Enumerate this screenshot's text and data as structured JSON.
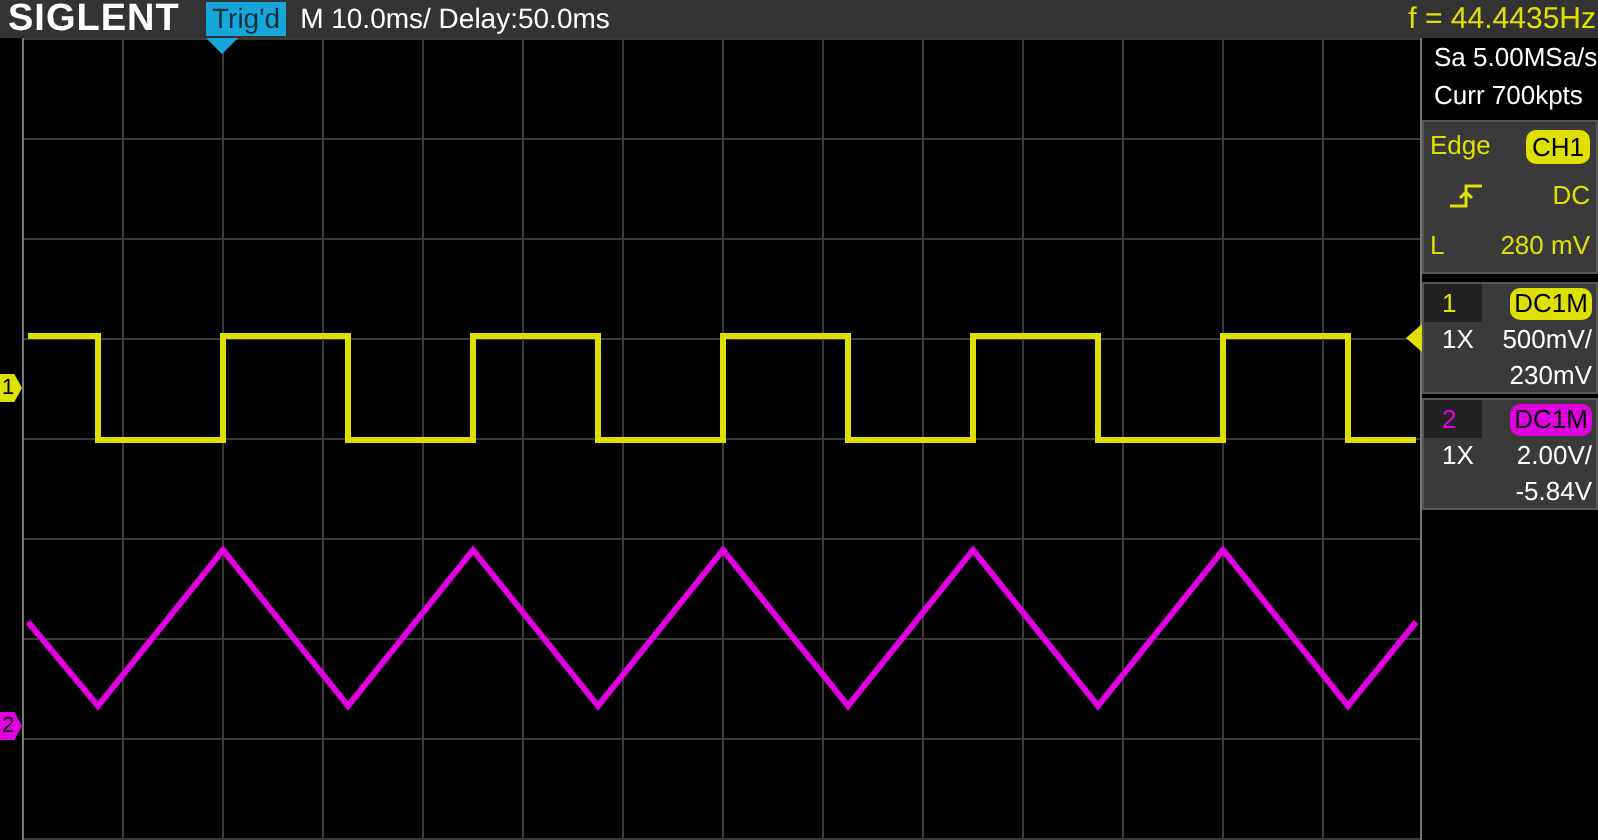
{
  "top_bar": {
    "brand": "SIGLENT",
    "trigger_status": "Trig'd",
    "timebase": "M 10.0ms/ Delay:50.0ms",
    "frequency": "f = 44.4435Hz"
  },
  "acquisition": {
    "sample_rate": "Sa 5.00MSa/s",
    "memory_depth": "Curr 700kpts"
  },
  "trigger": {
    "type": "Edge",
    "source": "CH1",
    "kind": "rising",
    "coupling": "DC",
    "level_label": "L",
    "level": "280 mV"
  },
  "channels": [
    {
      "number": "1",
      "marker": "1",
      "coupling": "DC1M",
      "probe": "1X",
      "scale": "500mV/",
      "offset": "230mV",
      "color": "#e0e000",
      "kind": "square"
    },
    {
      "number": "2",
      "marker": "2",
      "coupling": "DC1M",
      "probe": "1X",
      "scale": "2.00V/",
      "offset": "-5.84V",
      "color": "#e000e0",
      "kind": "triangle"
    }
  ]
}
